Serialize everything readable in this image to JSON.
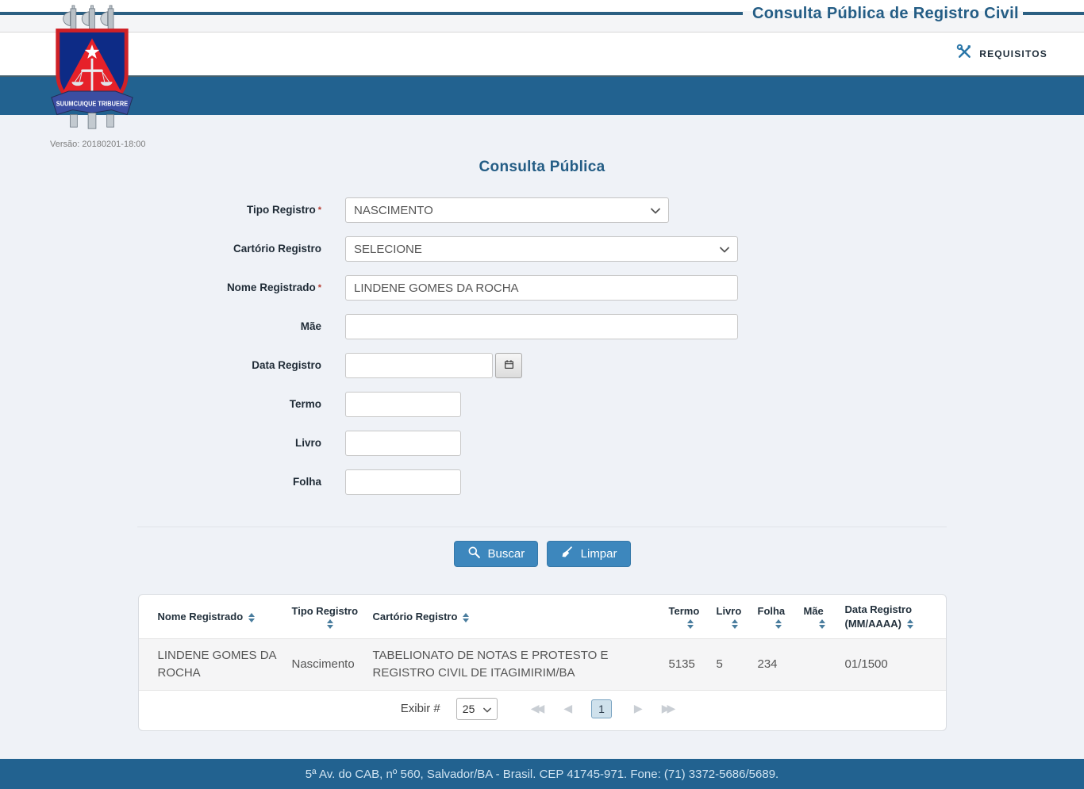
{
  "header": {
    "app_title": "Consulta Pública de Registro Civil",
    "requisitos_label": "REQUISITOS",
    "version_label": "Versão: 20180201-18:00",
    "crest_motto": "SUUMCUIQUE TRIBUERE"
  },
  "form": {
    "title": "Consulta Pública",
    "required_marker": "*",
    "fields": {
      "tipo_registro": {
        "label": "Tipo Registro",
        "value": "NASCIMENTO"
      },
      "cartorio_registro": {
        "label": "Cartório Registro",
        "value": "SELECIONE"
      },
      "nome_registrado": {
        "label": "Nome Registrado",
        "value": "LINDENE GOMES DA ROCHA"
      },
      "mae": {
        "label": "Mãe",
        "value": ""
      },
      "data_registro": {
        "label": "Data Registro",
        "value": ""
      },
      "termo": {
        "label": "Termo",
        "value": ""
      },
      "livro": {
        "label": "Livro",
        "value": ""
      },
      "folha": {
        "label": "Folha",
        "value": ""
      }
    },
    "buttons": {
      "buscar": "Buscar",
      "limpar": "Limpar"
    }
  },
  "results": {
    "columns": [
      {
        "label": "Nome Registrado"
      },
      {
        "label": "Tipo Registro"
      },
      {
        "label": "Cartório Registro"
      },
      {
        "label": "Termo"
      },
      {
        "label": "Livro"
      },
      {
        "label": "Folha"
      },
      {
        "label": "Mãe"
      },
      {
        "label": "Data Registro",
        "label2": "(MM/AAAA)"
      }
    ],
    "rows": [
      {
        "nome_registrado": "LINDENE GOMES DA ROCHA",
        "tipo_registro": "Nascimento",
        "cartorio_registro": "TABELIONATO DE NOTAS E PROTESTO E REGISTRO CIVIL DE ITAGIMIRIM/BA",
        "termo": "5135",
        "livro": "5",
        "folha": "234",
        "mae": "",
        "data_registro": "01/1500"
      }
    ],
    "pagination": {
      "exibir_label": "Exibir #",
      "page_size": "25",
      "current_page": "1",
      "first_icon": "◀◀",
      "prev_icon": "◀",
      "next_icon": "▶",
      "last_icon": "▶▶"
    }
  },
  "footer": {
    "address": "5ª Av. do CAB, nº 560, Salvador/BA - Brasil. CEP 41745-971. Fone: (71) 3372-5686/5689."
  },
  "colors": {
    "banner_blue": "#226290",
    "title_blue": "#245d85",
    "button_blue": "#3d87bd",
    "label_dark": "#1f2b36",
    "required_red": "#b63a30"
  }
}
